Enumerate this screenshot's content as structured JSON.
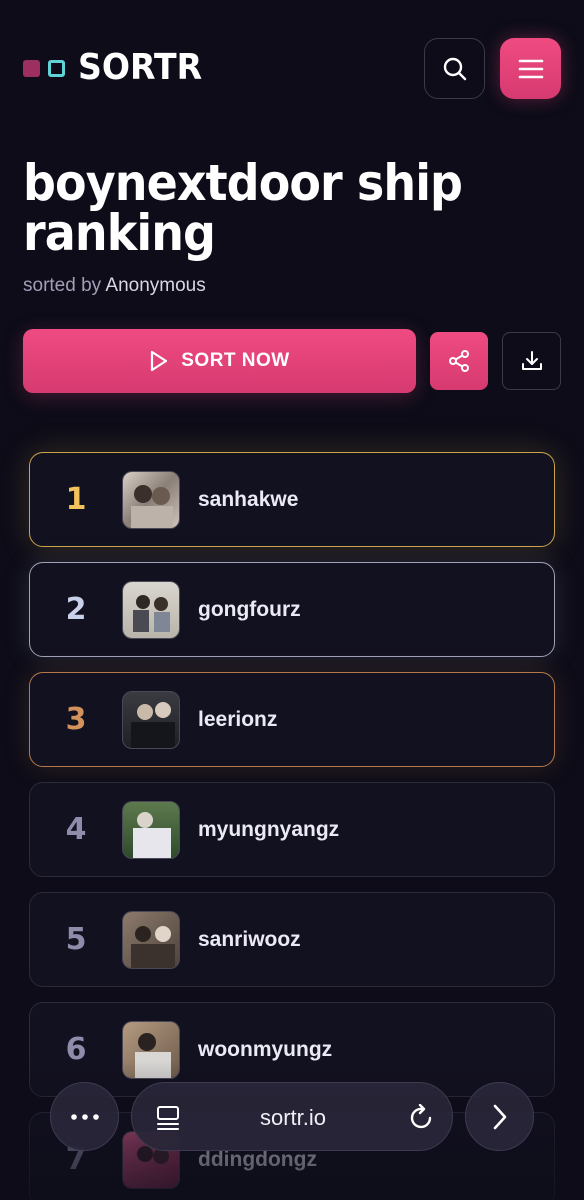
{
  "header": {
    "logo_text": "SORTR",
    "brand_colors": {
      "accent": "#e8467c",
      "square1": "#9c2f5f",
      "square2": "#5fd3d6"
    }
  },
  "page": {
    "title": "boynextdoor ship ranking",
    "sorted_by_prefix": "sorted by",
    "author": "Anonymous"
  },
  "actions": {
    "sort_now_label": "SORT NOW"
  },
  "ranking": [
    {
      "rank": "1",
      "name": "sanhakwe",
      "tier": "gold"
    },
    {
      "rank": "2",
      "name": "gongfourz",
      "tier": "silver"
    },
    {
      "rank": "3",
      "name": "leerionz",
      "tier": "bronze"
    },
    {
      "rank": "4",
      "name": "myungnyangz",
      "tier": "normal"
    },
    {
      "rank": "5",
      "name": "sanriwooz",
      "tier": "normal"
    },
    {
      "rank": "6",
      "name": "woonmyungz",
      "tier": "normal"
    },
    {
      "rank": "7",
      "name": "ddingdongz",
      "tier": "normal"
    }
  ],
  "browser_bar": {
    "url": "sortr.io"
  },
  "icons": [
    "search-icon",
    "menu-icon",
    "play-icon",
    "share-icon",
    "download-icon",
    "more-icon",
    "tabs-icon",
    "reload-icon",
    "chevron-right-icon"
  ]
}
